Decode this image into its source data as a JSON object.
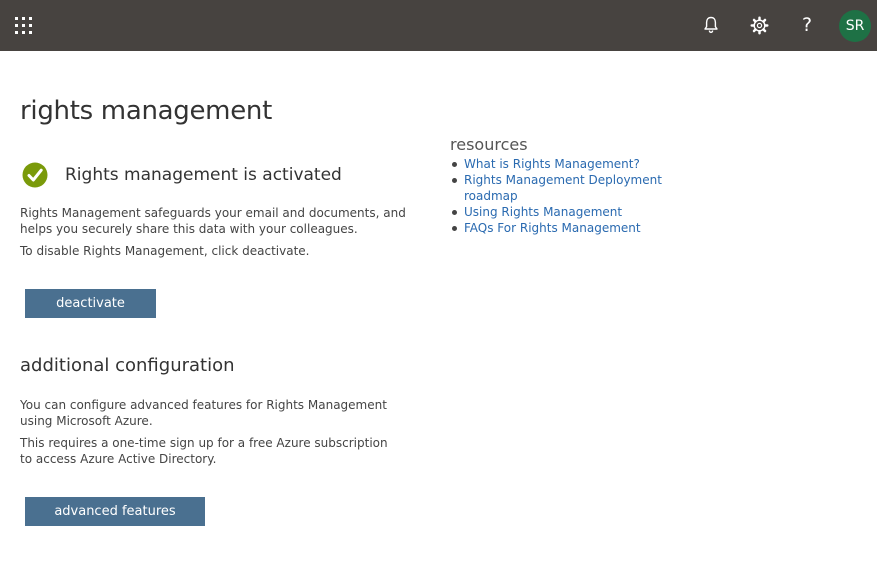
{
  "topbar": {
    "app_launcher_icon": "waffle-icon",
    "notifications_icon": "bell-icon",
    "settings_icon": "gear-icon",
    "help_icon": "question-mark-icon",
    "help_glyph": "?",
    "avatar_initials": "SR",
    "colors": {
      "bar_background": "#474340",
      "avatar_background": "#1e7145"
    }
  },
  "page": {
    "title": "rights management"
  },
  "status": {
    "icon": "check-circle-icon",
    "text": "Rights management is activated",
    "colors": {
      "check_background": "#7a9a0a"
    }
  },
  "description": {
    "para1": "Rights Management safeguards your email and documents, and helps you securely share this data with your colleagues.",
    "para2": "To disable Rights Management, click deactivate."
  },
  "deactivate_button": {
    "label": "deactivate"
  },
  "additional": {
    "title": "additional configuration",
    "para1": "You can configure advanced features for Rights Management using Microsoft Azure.",
    "para2": "This requires a one-time sign up for a free Azure subscription to access Azure Active Directory."
  },
  "advanced_button": {
    "label": "advanced features"
  },
  "buttons": {
    "colors": {
      "background": "#4a7090"
    }
  },
  "resources": {
    "title": "resources",
    "links": [
      {
        "label": "What is Rights Management?"
      },
      {
        "label": "Rights Management Deployment roadmap"
      },
      {
        "label": "Using Rights Management"
      },
      {
        "label": "FAQs For Rights Management"
      }
    ],
    "colors": {
      "link": "#2a6ab0"
    }
  }
}
